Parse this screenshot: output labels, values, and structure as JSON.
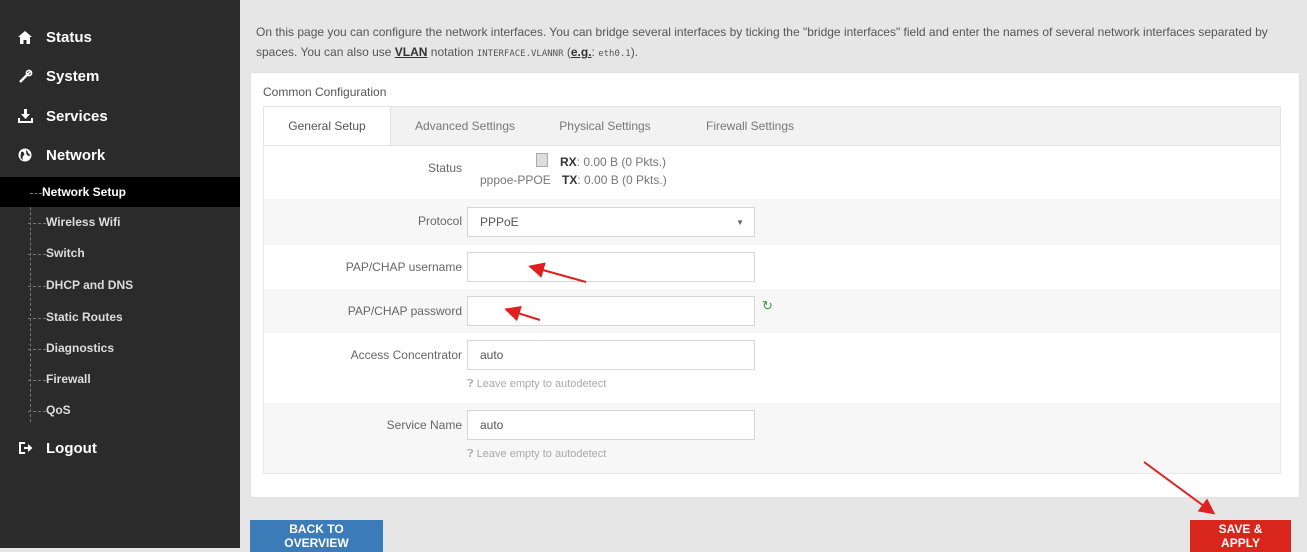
{
  "sidebar": {
    "status": {
      "label": "Status",
      "icon": "home-icon"
    },
    "system": {
      "label": "System",
      "icon": "tools-icon"
    },
    "services": {
      "label": "Services",
      "icon": "download-icon"
    },
    "network": {
      "label": "Network",
      "icon": "globe-icon"
    },
    "network_items": [
      "Network Setup",
      "Wireless Wifi",
      "Switch",
      "DHCP and DNS",
      "Static Routes",
      "Diagnostics",
      "Firewall",
      "QoS"
    ],
    "logout": {
      "label": "Logout",
      "icon": "logout-icon"
    }
  },
  "intro": {
    "text1": "On this page you can configure the network interfaces. You can bridge several interfaces by ticking the \"bridge interfaces\" field and enter the names of several network interfaces separated by spaces. You can also use ",
    "vlan_link": "VLAN",
    "text2": " notation ",
    "code1": "INTERFACE.VLANNR",
    "text3": " (",
    "eg_link": "e.g.",
    "text4": ": ",
    "code2": "eth0.1",
    "text5": ")."
  },
  "card": {
    "title": "Common Configuration",
    "tabs": [
      "General Setup",
      "Advanced Settings",
      "Physical Settings",
      "Firewall Settings"
    ]
  },
  "form": {
    "status_label": "Status",
    "interface_name": "pppoe-PPOE",
    "rx_label": "RX",
    "rx_value": ": 0.00 B (0 Pkts.)",
    "tx_label": "TX",
    "tx_value": ": 0.00 B (0 Pkts.)",
    "protocol_label": "Protocol",
    "protocol_value": "PPPoE",
    "username_label": "PAP/CHAP username",
    "username_value": "",
    "password_label": "PAP/CHAP password",
    "password_value": "",
    "ac_label": "Access Concentrator",
    "ac_value": "auto",
    "ac_hint": "Leave empty to autodetect",
    "service_label": "Service Name",
    "service_value": "auto",
    "service_hint": "Leave empty to autodetect"
  },
  "buttons": {
    "back": "BACK TO OVERVIEW",
    "save": "SAVE & APPLY"
  },
  "colors": {
    "sidebar_bg": "#2b2b2b",
    "back_button": "#3a7bb8",
    "save_button": "#d9261c",
    "annotation_arrow": "#e02020"
  }
}
